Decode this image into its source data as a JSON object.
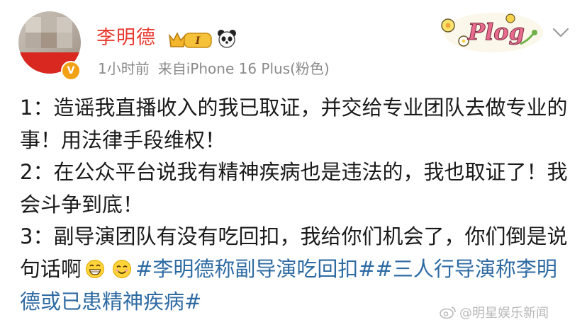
{
  "post": {
    "author": "李明德",
    "badge_level": "I",
    "verified_mark": "V",
    "time": "1小时前",
    "source": "来自iPhone 16 Plus(粉色)",
    "sticker_text": "Plog",
    "menu_icon": "chevron-down-icon",
    "paragraph1": "1：造谣我直播收入的我已取证，并交给专业团队去做专业的事！用法律手段维权！",
    "paragraph2": "2：在公众平台说我有精神疾病也是违法的，我也取证了！我会斗争到底！",
    "paragraph3_text": "3：副导演团队有没有吃回扣，我给你们机会了，你们倒是说句话啊",
    "emojis": [
      "grin-emoji-icon",
      "smile-emoji-icon"
    ],
    "hashtag1": "#李明德称副导演吃回扣#",
    "hashtag2": "#三人行导演称李明德或已患精神疾病#"
  },
  "watermark": {
    "text": "@明星娱乐新闻",
    "icon": "weibo-logo-icon"
  },
  "colors": {
    "author": "#e8392e",
    "hashtag": "#2f6ba3",
    "meta": "#8a8a8a",
    "verified": "#f2a114"
  }
}
